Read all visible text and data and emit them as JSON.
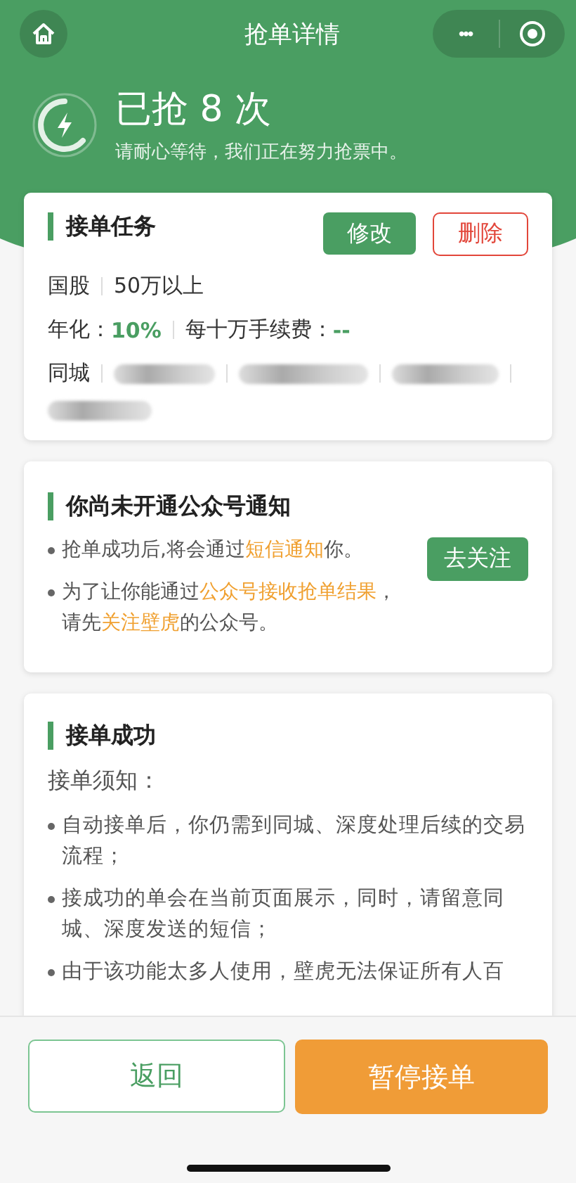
{
  "nav": {
    "title": "抢单详情",
    "menu_glyph": "•••"
  },
  "status": {
    "title": "已抢 8 次",
    "subtitle": "请耐心等待，我们正在努力抢票中。"
  },
  "task_card": {
    "title": "接单任务",
    "edit_button": "修改",
    "delete_button": "删除",
    "type": "国股",
    "amount": "50万以上",
    "rate_label": "年化：",
    "rate_value": "10%",
    "fee_label": "每十万手续费：",
    "fee_value": "--",
    "city_label": "同城"
  },
  "notice_card": {
    "title": "你尚未开通公众号通知",
    "follow_button": "去关注",
    "bullets": [
      [
        {
          "text": "抢单成功后,将会通过",
          "highlight": false
        },
        {
          "text": "短信通知",
          "highlight": true
        },
        {
          "text": "你。",
          "highlight": false
        }
      ],
      [
        {
          "text": "为了让你能通过",
          "highlight": false
        },
        {
          "text": "公众号接收抢单结果",
          "highlight": true
        },
        {
          "text": "，请先",
          "highlight": false
        },
        {
          "text": "关注壁虎",
          "highlight": true
        },
        {
          "text": "的公众号。",
          "highlight": false
        }
      ]
    ]
  },
  "success_card": {
    "title": "接单成功",
    "subtitle": "接单须知：",
    "bullets": [
      "自动接单后，你仍需到同城、深度处理后续的交易流程；",
      "接成功的单会在当前页面展示，同时，请留意同城、深度发送的短信；",
      "由于该功能太多人使用，壁虎无法保证所有人百"
    ]
  },
  "bottom": {
    "back_button": "返回",
    "pause_button": "暂停接单"
  }
}
